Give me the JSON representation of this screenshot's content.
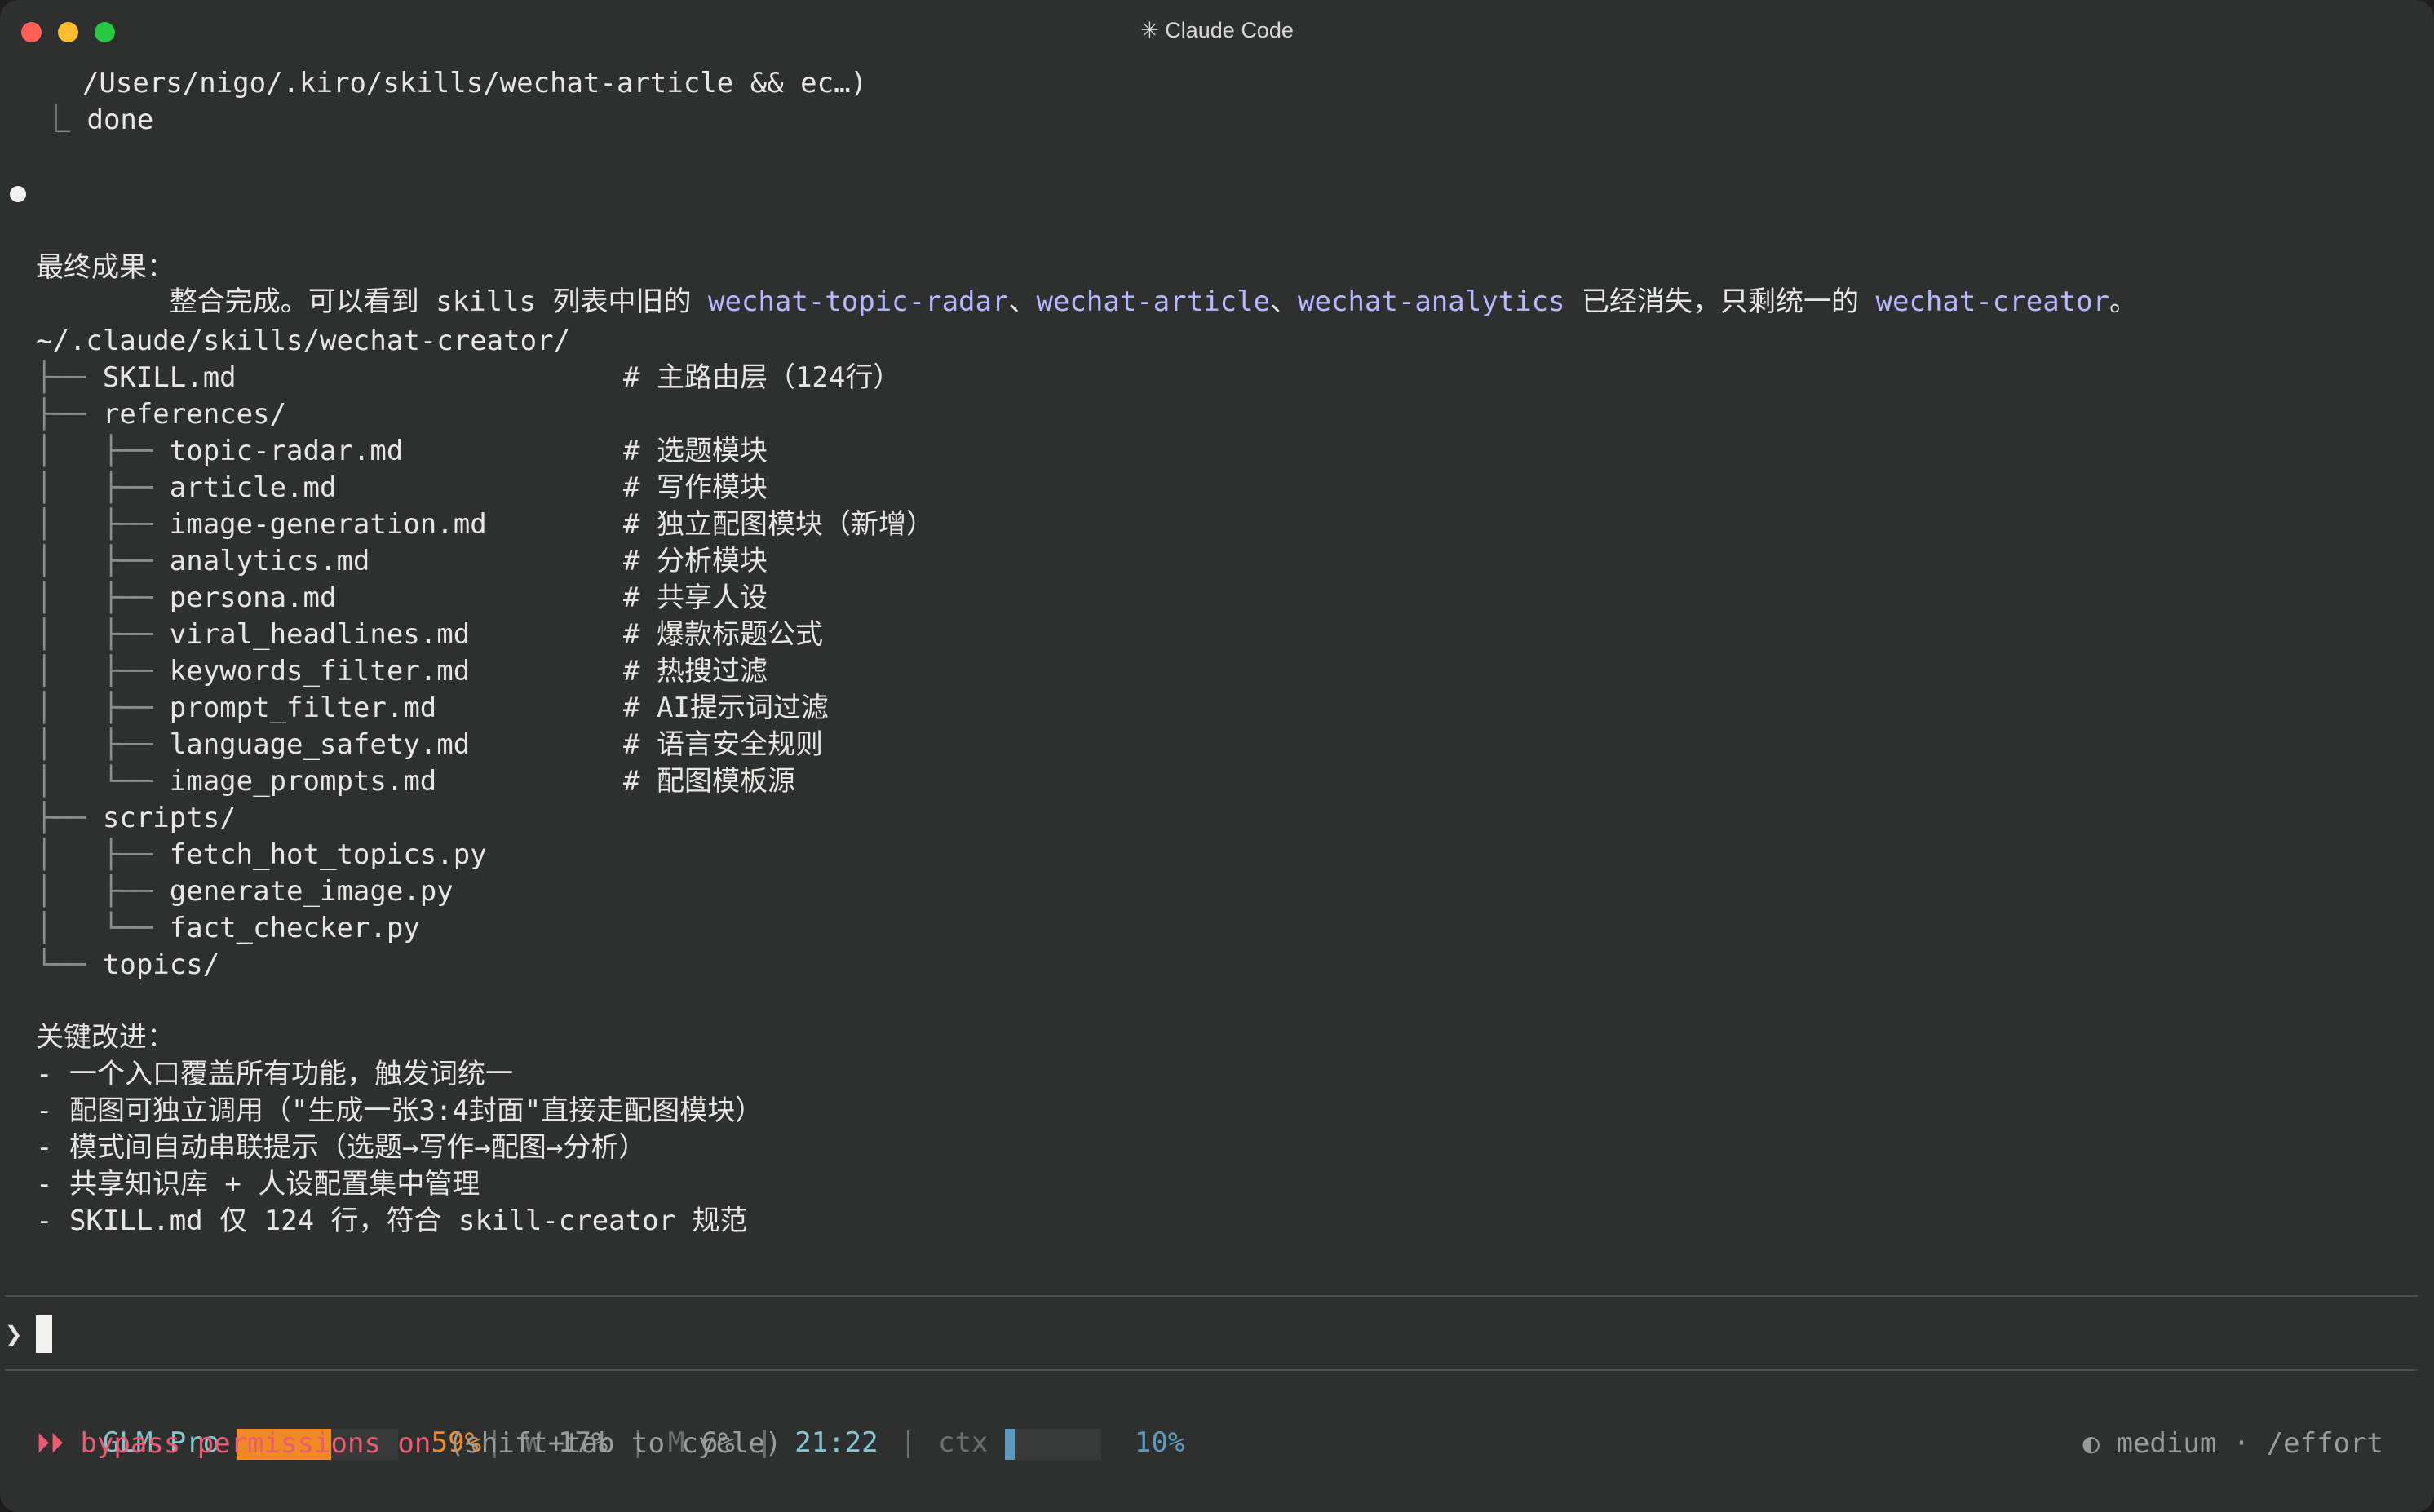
{
  "window": {
    "title": "✳ Claude Code"
  },
  "output": {
    "cmd_tail": "  /Users/nigo/.kiro/skills/wechat-article && ec…)",
    "result_prefix": "⎿",
    "result_text": "done",
    "summary": {
      "part1": "整合完成。可以看到 skills 列表中旧的 ",
      "skill1": "wechat-topic-radar",
      "sep1": "、",
      "skill2": "wechat-article",
      "sep2": "、",
      "skill3": "wechat-analytics",
      "part2": " 已经消失，只剩统一的 ",
      "skill4": "wechat-creator",
      "part3": "。"
    },
    "final_heading": "最终成果：",
    "tree_root": "~/.claude/skills/wechat-creator/",
    "tree": [
      {
        "prefix": "├── ",
        "name": "SKILL.md",
        "comment": "# 主路由层（124行）"
      },
      {
        "prefix": "├── ",
        "name": "references/",
        "comment": ""
      },
      {
        "prefix": "│   ├── ",
        "name": "topic-radar.md",
        "comment": "# 选题模块"
      },
      {
        "prefix": "│   ├── ",
        "name": "article.md",
        "comment": "# 写作模块"
      },
      {
        "prefix": "│   ├── ",
        "name": "image-generation.md",
        "comment": "# 独立配图模块（新增）"
      },
      {
        "prefix": "│   ├── ",
        "name": "analytics.md",
        "comment": "# 分析模块"
      },
      {
        "prefix": "│   ├── ",
        "name": "persona.md",
        "comment": "# 共享人设"
      },
      {
        "prefix": "│   ├── ",
        "name": "viral_headlines.md",
        "comment": "# 爆款标题公式"
      },
      {
        "prefix": "│   ├── ",
        "name": "keywords_filter.md",
        "comment": "# 热搜过滤"
      },
      {
        "prefix": "│   ├── ",
        "name": "prompt_filter.md",
        "comment": "# AI提示词过滤"
      },
      {
        "prefix": "│   ├── ",
        "name": "language_safety.md",
        "comment": "# 语言安全规则"
      },
      {
        "prefix": "│   └── ",
        "name": "image_prompts.md",
        "comment": "# 配图模板源"
      },
      {
        "prefix": "├── ",
        "name": "scripts/",
        "comment": ""
      },
      {
        "prefix": "│   ├── ",
        "name": "fetch_hot_topics.py",
        "comment": ""
      },
      {
        "prefix": "│   ├── ",
        "name": "generate_image.py",
        "comment": ""
      },
      {
        "prefix": "│   └── ",
        "name": "fact_checker.py",
        "comment": ""
      },
      {
        "prefix": "└── ",
        "name": "topics/",
        "comment": ""
      }
    ],
    "improvements_heading": "关键改进：",
    "improvements": [
      "- 一个入口覆盖所有功能，触发词统一",
      "- 配图可独立调用（\"生成一张3:4封面\"直接走配图模块）",
      "- 模式间自动串联提示（选题→写作→配图→分析）",
      "- 共享知识库 + 人设配置集中管理",
      "- SKILL.md 仅 124 行，符合 skill-creator 规范"
    ]
  },
  "prompt": {
    "symbol": "❯"
  },
  "status": {
    "plan": "GLM Pro",
    "usage_percent": 59,
    "usage_label": "59%",
    "pipe": "|",
    "w_label": "W",
    "w_value": "17%",
    "m_label": "M",
    "m_value": "6%",
    "time": "21:22",
    "ctx_label": "ctx",
    "ctx_percent": 10,
    "ctx_value": "10%",
    "colors": {
      "plan": "#7fc6d0",
      "usage_bar": "#f08a24",
      "usage_text": "#f08a24",
      "time": "#7fc6d0",
      "ctx_bar": "#5b9bbf",
      "ctx_text": "#5b9bbf",
      "dim": "#6c6f6c"
    }
  },
  "permission": {
    "arrows": "⏵⏵",
    "label": "bypass permissions on",
    "hint": " (shift+tab to cycle)",
    "color": "#ee5a6f"
  },
  "effort": {
    "icon": "◐",
    "text": " medium · /effort"
  }
}
